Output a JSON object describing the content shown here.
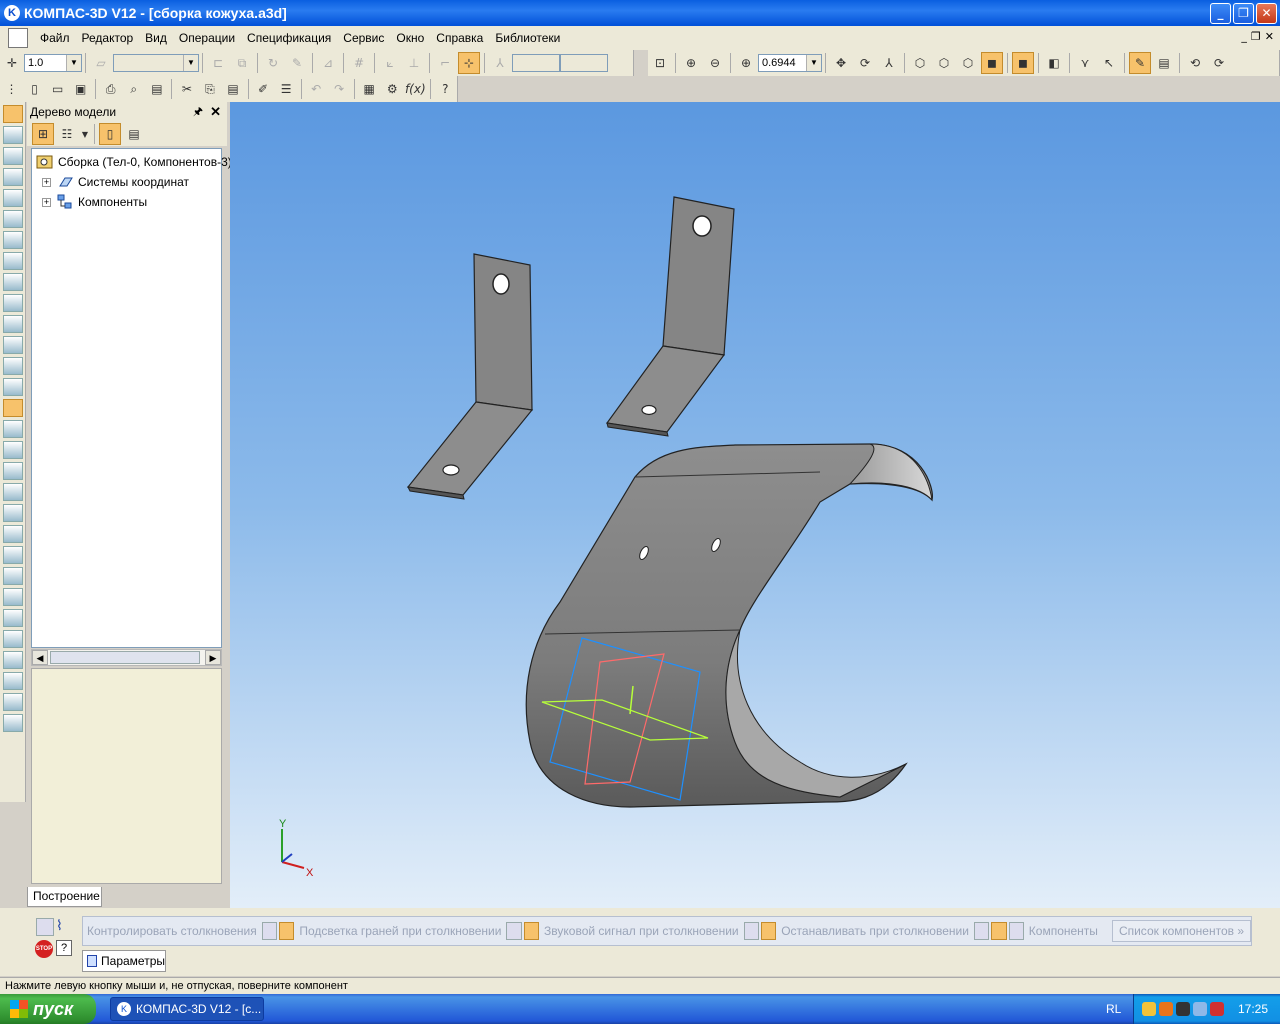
{
  "window": {
    "title": "КОМПАС-3D V12 - [сборка кожуха.a3d]",
    "controls": [
      "_",
      "❐",
      "✕"
    ]
  },
  "menu": {
    "items": [
      "Файл",
      "Редактор",
      "Вид",
      "Операции",
      "Спецификация",
      "Сервис",
      "Окно",
      "Справка",
      "Библиотеки"
    ]
  },
  "mdi_controls": [
    "_",
    "❐",
    "✕"
  ],
  "toolbar": {
    "step_value": "1.0",
    "zoom_value": "0.6944"
  },
  "model_tree": {
    "title": "Дерево модели",
    "root": "Сборка (Тел-0, Компонентов-3)",
    "children": [
      "Системы координат",
      "Компоненты"
    ]
  },
  "panel_tab": "Построение",
  "axes": {
    "x": "X",
    "y": "Y"
  },
  "bottom_panel": {
    "items": [
      "Контролировать столкновения",
      "Подсветка граней при столкновении",
      "Звуковой сигнал при столкновении",
      "Останавливать при столкновении",
      "Компоненты"
    ],
    "button": "Список компонентов",
    "tab": "Параметры",
    "stop_label": "STOP"
  },
  "status": {
    "text": "Нажмите левую кнопку мыши и, не отпуская, поверните компонент"
  },
  "taskbar": {
    "start": "пуск",
    "task": "КОМПАС-3D V12 - [с...",
    "lang": "RL",
    "time": "17:25"
  },
  "colors": {
    "accent": "#0a5fe0",
    "active_tool": "#f7c26b",
    "model_gray": "#8d8d8d"
  }
}
